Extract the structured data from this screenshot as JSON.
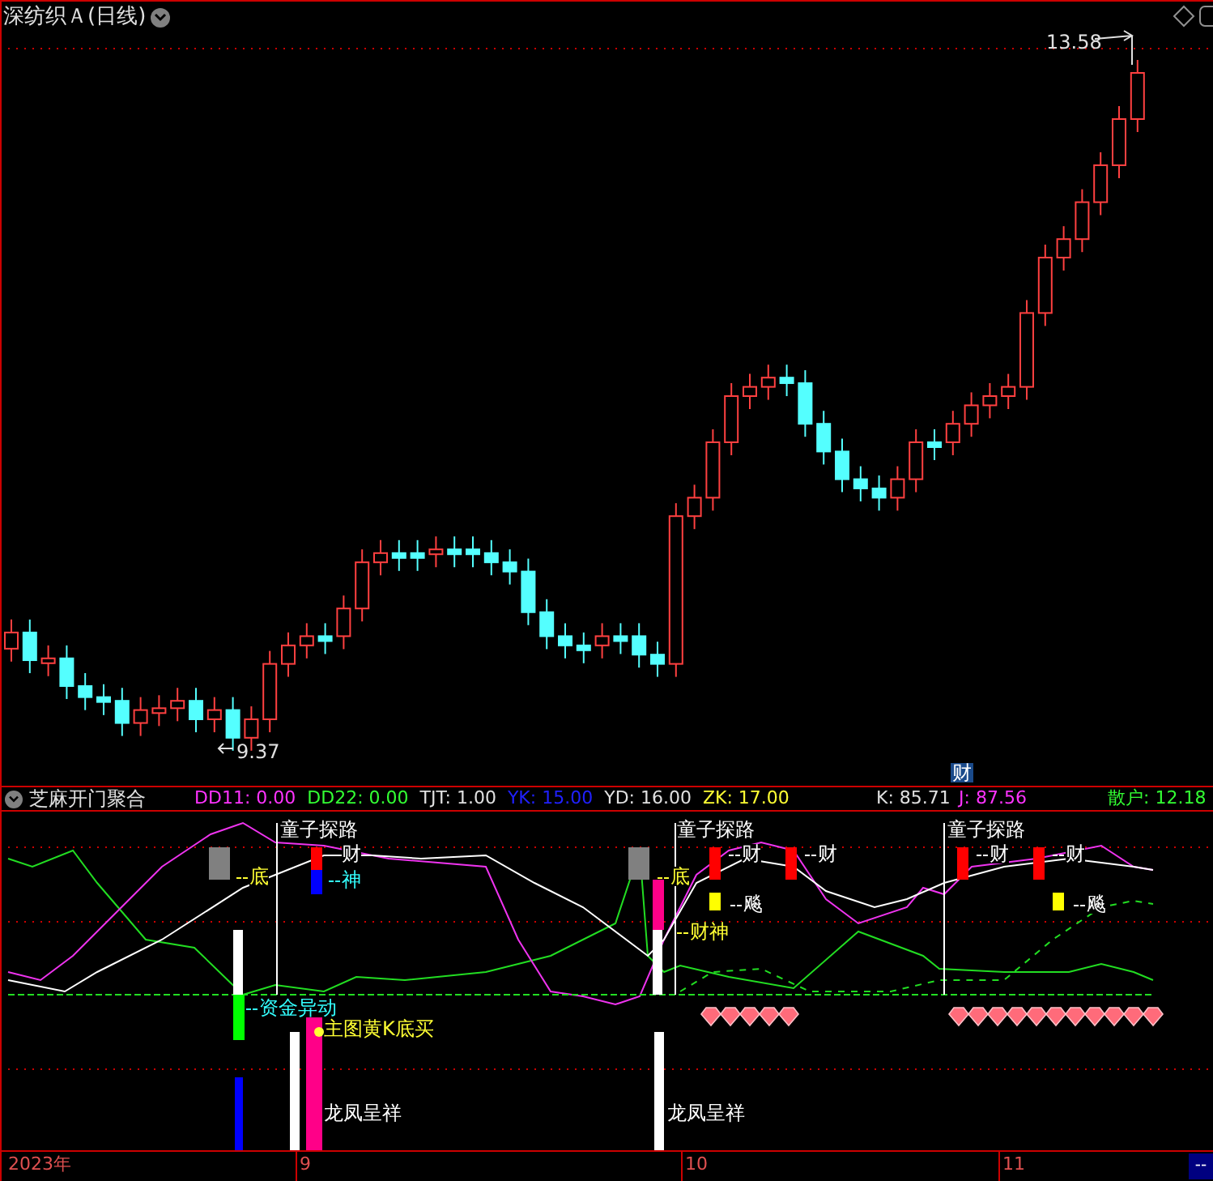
{
  "main_chart": {
    "title": "深纺织Ａ(日线)",
    "high_label": "13.58",
    "low_label": "9.37",
    "marker": "财"
  },
  "indicator": {
    "name": "芝麻开门聚合",
    "values": [
      {
        "text": "DD11: 0.00",
        "color": "#ff33ff"
      },
      {
        "text": "DD22: 0.00",
        "color": "#33ff33"
      },
      {
        "text": "TJT: 1.00",
        "color": "#e0e0e0"
      },
      {
        "text": "YK: 15.00",
        "color": "#2020ff"
      },
      {
        "text": "YD: 16.00",
        "color": "#e0e0e0"
      },
      {
        "text": "ZK: 17.00",
        "color": "#ffff33"
      }
    ],
    "right_values": [
      {
        "text": "K: 85.71",
        "color": "#e0e0e0"
      },
      {
        "text": "J: 87.56",
        "color": "#ff33ff"
      },
      {
        "text": "散户: 12.18",
        "color": "#33ff33"
      }
    ],
    "signals": [
      {
        "kind": "bottom",
        "text": "底"
      },
      {
        "kind": "probe",
        "text": "童子探路"
      },
      {
        "kind": "wealth",
        "text": "财"
      },
      {
        "kind": "god",
        "text": "神"
      },
      {
        "kind": "fund",
        "text": "资金异动"
      },
      {
        "kind": "buy",
        "text": "主图黄K底买"
      },
      {
        "kind": "dragon",
        "text": "龙凤呈祥"
      },
      {
        "kind": "probe",
        "text": "童子探路"
      },
      {
        "kind": "bottom",
        "text": "底"
      },
      {
        "kind": "wealth",
        "text": "财"
      },
      {
        "kind": "wealth",
        "text": "财"
      },
      {
        "kind": "gust",
        "text": "飚"
      },
      {
        "kind": "wealthgod",
        "text": "财神"
      },
      {
        "kind": "dragon",
        "text": "龙凤呈祥"
      },
      {
        "kind": "probe",
        "text": "童子探路"
      },
      {
        "kind": "wealth",
        "text": "财"
      },
      {
        "kind": "wealth",
        "text": "财"
      },
      {
        "kind": "gust",
        "text": "飚"
      }
    ]
  },
  "time_axis": {
    "labels": [
      "2023年",
      "9",
      "10",
      "11"
    ],
    "button": "--"
  }
}
